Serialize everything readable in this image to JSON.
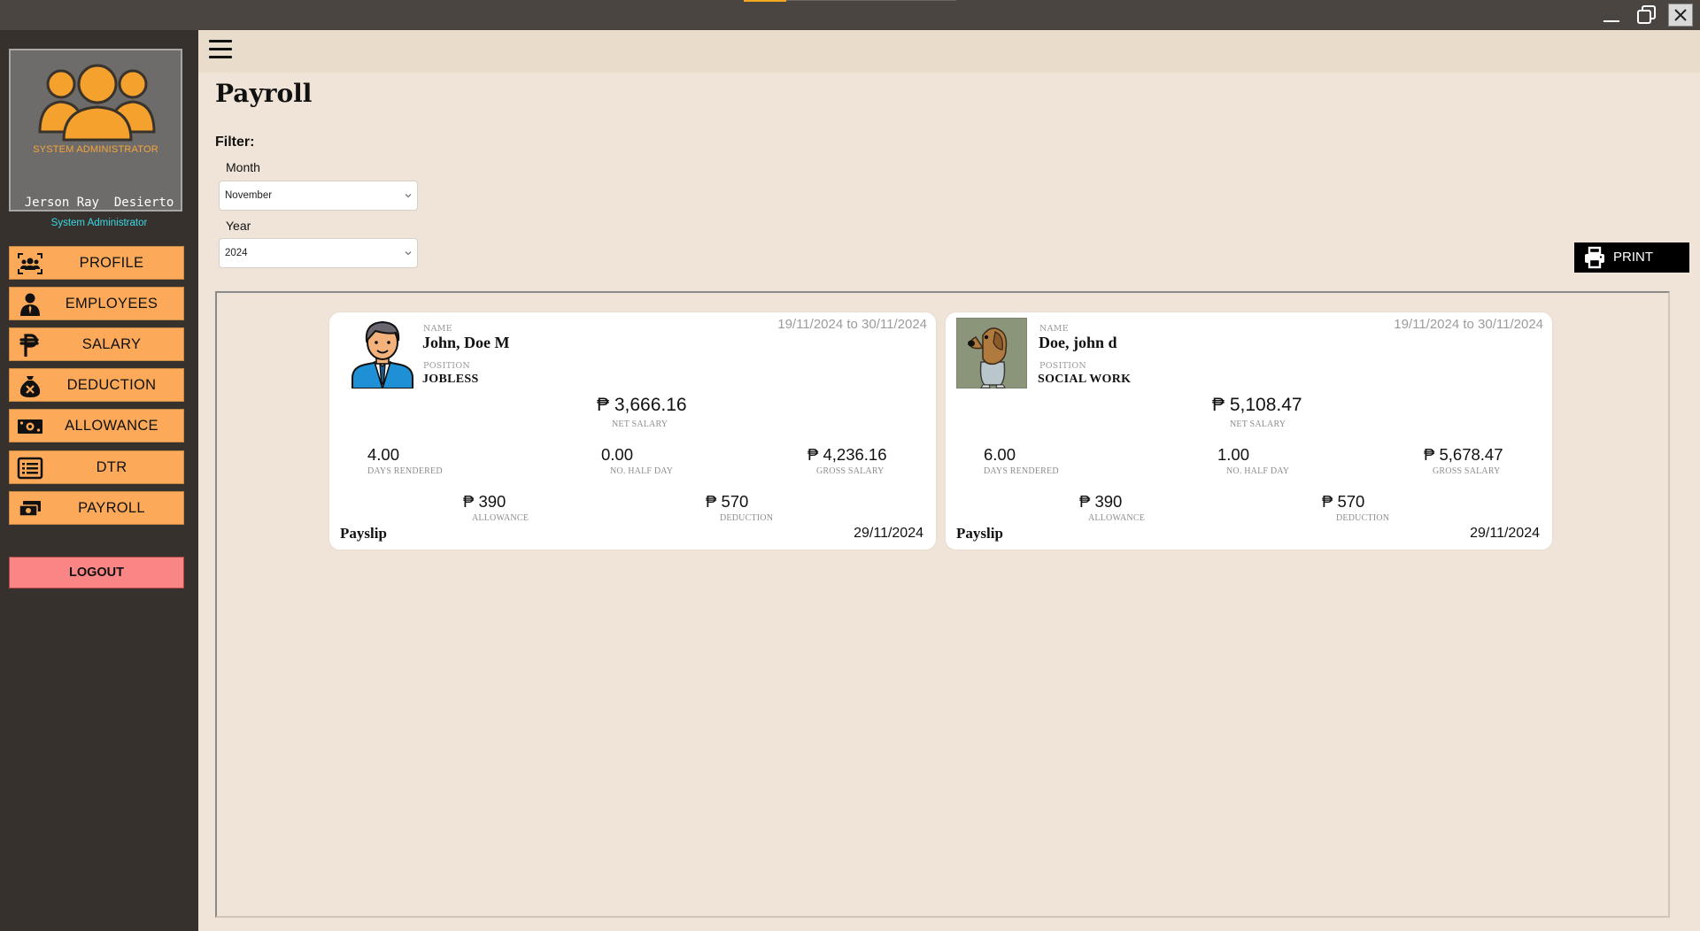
{
  "sidebar": {
    "avatar_caption": "SYSTEM ADMINISTRATOR",
    "user_name": "Jerson Ray  Desierto",
    "user_role": "System Administrator",
    "nav": [
      {
        "label": "PROFILE",
        "icon": "users-icon"
      },
      {
        "label": "EMPLOYEES",
        "icon": "employee-icon"
      },
      {
        "label": "SALARY",
        "icon": "peso-icon"
      },
      {
        "label": "DEDUCTION",
        "icon": "money-bag-x-icon"
      },
      {
        "label": "ALLOWANCE",
        "icon": "money-bill-icon"
      },
      {
        "label": "DTR",
        "icon": "list-icon"
      },
      {
        "label": "PAYROLL",
        "icon": "cash-stack-icon"
      }
    ],
    "logout_label": "LOGOUT"
  },
  "page": {
    "title": "Payroll",
    "filter_label": "Filter:",
    "month_label": "Month",
    "month_value": "November",
    "year_label": "Year",
    "year_value": "2024",
    "print_label": "PRINT"
  },
  "labels": {
    "name": "NAME",
    "position": "POSITION",
    "net_salary": "NET SALARY",
    "days_rendered": "DAYS RENDERED",
    "half_day": "NO. HALF DAY",
    "gross_salary": "GROSS SALARY",
    "allowance": "ALLOWANCE",
    "deduction": "DEDUCTION",
    "payslip": "Payslip"
  },
  "payslips": [
    {
      "name": "John, Doe M",
      "position": "JOBLESS",
      "period": "19/11/2024 to 30/11/2024",
      "net_salary": "₱ 3,666.16",
      "days_rendered": "4.00",
      "half_day": "0.00",
      "gross_salary": "₱ 4,236.16",
      "allowance": "₱ 390",
      "deduction": "₱ 570",
      "date": "29/11/2024",
      "photo": "man-avatar-icon"
    },
    {
      "name": "Doe, john d",
      "position": "SOCIAL WORK",
      "period": "19/11/2024 to 30/11/2024",
      "net_salary": "₱ 5,108.47",
      "days_rendered": "6.00",
      "half_day": "1.00",
      "gross_salary": "₱ 5,678.47",
      "allowance": "₱ 390",
      "deduction": "₱ 570",
      "date": "29/11/2024",
      "photo": "dog-avatar-icon"
    }
  ],
  "colors": {
    "sidebar_bg": "#36312c",
    "nav_button": "#fcaa5a",
    "logout_button": "#fa8585",
    "main_bg": "#f0e4d8",
    "role_accent": "#39d9e6"
  }
}
